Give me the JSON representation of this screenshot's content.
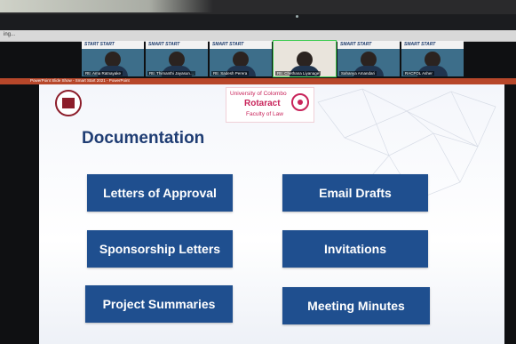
{
  "window": {
    "title_strip": "ing...",
    "ppt_bar_title": "PowerPoint Slide Show - Smart Start 2021 - PowerPoint"
  },
  "participants": [
    {
      "banner": "START START",
      "name": "Rtr. Ama Ratnayake"
    },
    {
      "banner": "SMART START",
      "name": "Rtr. Thimanthi Jayasun..."
    },
    {
      "banner": "SMART START",
      "name": "Rtr. Sadesh Perera"
    },
    {
      "banner": "",
      "name": "Rtr. Chethana Liyanage"
    },
    {
      "banner": "SMART START",
      "name": "Sahanya Amandari"
    },
    {
      "banner": "SMART START",
      "name": "RACFOL Asher"
    }
  ],
  "slide": {
    "rotaract_line1": "University of Colombo",
    "rotaract_line2": "Rotaract",
    "rotaract_line3": "Faculty of Law",
    "heading": "Documentation",
    "buttons": {
      "approval": "Letters of Approval",
      "email_drafts": "Email Drafts",
      "sponsorship": "Sponsorship Letters",
      "invitations": "Invitations",
      "summaries": "Project Summaries",
      "minutes": "Meeting Minutes"
    }
  },
  "colors": {
    "slide_accent": "#1f4f8f",
    "heading": "#1f3d73",
    "rotaract_brand": "#c8235a",
    "ppt_bar": "#b7472a"
  }
}
